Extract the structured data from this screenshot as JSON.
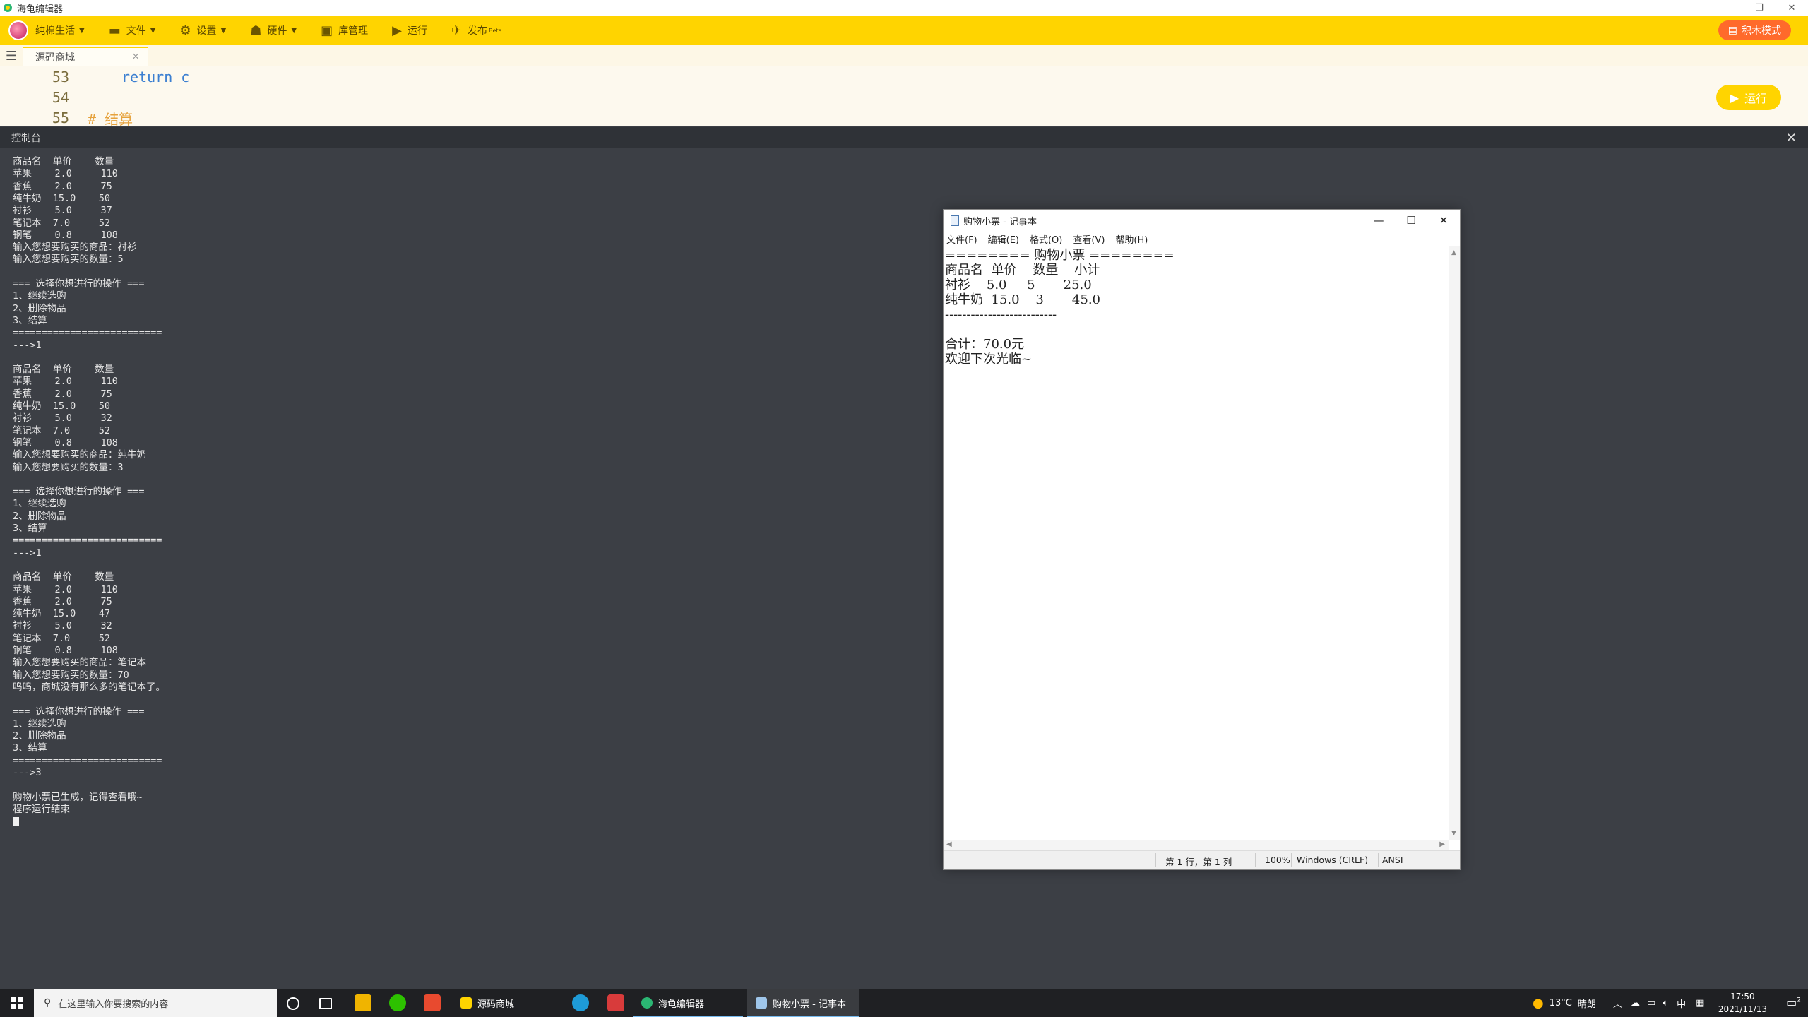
{
  "app": {
    "title": "海龟编辑器",
    "window_controls": [
      "—",
      "❐",
      "✕"
    ]
  },
  "toolbar": {
    "user_name": "纯棉生活",
    "menu_file": "文件",
    "menu_settings": "设置",
    "menu_hardware": "硬件",
    "menu_library": "库管理",
    "menu_run": "运行",
    "menu_publish": "发布",
    "publish_badge": "Beta",
    "block_mode": "积木模式"
  },
  "tab": {
    "name": "源码商城",
    "close": "×"
  },
  "editor": {
    "lines": [
      {
        "num": "53",
        "code": "return c"
      },
      {
        "num": "54",
        "code": ""
      },
      {
        "num": "55",
        "code": "# 结算"
      }
    ],
    "run_label": "运行"
  },
  "console": {
    "title": "控制台",
    "close": "✕",
    "lines": [
      "商品名  单价    数量",
      "苹果    2.0     110",
      "香蕉    2.0     75",
      "纯牛奶  15.0    50",
      "衬衫    5.0     37",
      "笔记本  7.0     52",
      "钢笔    0.8     108",
      "输入您想要购买的商品：衬衫",
      "输入您想要购买的数量：5",
      "",
      "=== 选择你想进行的操作 ===",
      "1、继续选购",
      "2、删除物品",
      "3、结算",
      "==========================",
      "--->1",
      "",
      "商品名  单价    数量",
      "苹果    2.0     110",
      "香蕉    2.0     75",
      "纯牛奶  15.0    50",
      "衬衫    5.0     32",
      "笔记本  7.0     52",
      "钢笔    0.8     108",
      "输入您想要购买的商品：纯牛奶",
      "输入您想要购买的数量：3",
      "",
      "=== 选择你想进行的操作 ===",
      "1、继续选购",
      "2、删除物品",
      "3、结算",
      "==========================",
      "--->1",
      "",
      "商品名  单价    数量",
      "苹果    2.0     110",
      "香蕉    2.0     75",
      "纯牛奶  15.0    47",
      "衬衫    5.0     32",
      "笔记本  7.0     52",
      "钢笔    0.8     108",
      "输入您想要购买的商品：笔记本",
      "输入您想要购买的数量：70",
      "呜呜，商城没有那么多的笔记本了。",
      "",
      "=== 选择你想进行的操作 ===",
      "1、继续选购",
      "2、删除物品",
      "3、结算",
      "==========================",
      "--->3",
      "",
      "购物小票已生成，记得查看哦~",
      "程序运行结束"
    ]
  },
  "notepad": {
    "title": "购物小票 - 记事本",
    "controls": [
      "—",
      "☐",
      "✕"
    ],
    "menu": [
      "文件(F)",
      "编辑(E)",
      "格式(O)",
      "查看(V)",
      "帮助(H)"
    ],
    "lines": [
      "======== 购物小票 ========",
      "商品名  单价    数量    小计",
      "衬衫    5.0     5       25.0",
      "纯牛奶  15.0    3       45.0",
      "--------------------------",
      "",
      "合计：70.0元",
      "欢迎下次光临~"
    ],
    "status": {
      "position": "第 1 行，第 1 列",
      "zoom": "100%",
      "eol": "Windows (CRLF)",
      "encoding": "ANSI"
    }
  },
  "taskbar": {
    "search_placeholder": "在这里输入你要搜索的内容",
    "apps": [
      {
        "label": "源码商城"
      },
      {
        "label": "海龟编辑器"
      },
      {
        "label": "购物小票 - 记事本"
      }
    ],
    "weather_temp": "13°C",
    "weather_text": "晴朗",
    "ime": "中",
    "time": "17:50",
    "date": "2021/11/13",
    "notification_count": "2"
  },
  "colors": {
    "toolbar_yellow": "#ffd400",
    "block_mode_orange": "#ff6a2b",
    "console_bg": "#3c3f45"
  }
}
